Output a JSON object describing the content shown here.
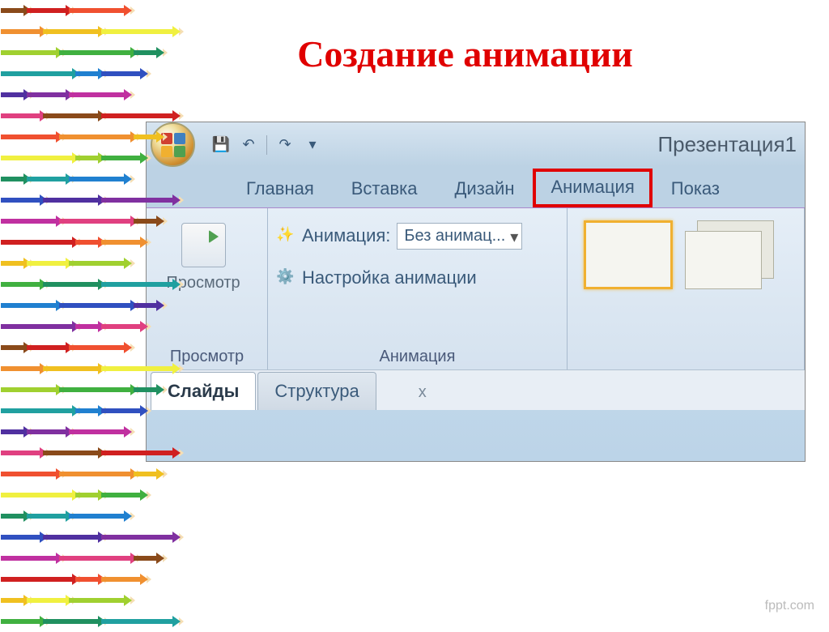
{
  "slide": {
    "title": "Создание анимации",
    "watermark": "fppt.com"
  },
  "app": {
    "doc_title": "Презентация1",
    "tabs": {
      "home": "Главная",
      "insert": "Вставка",
      "design": "Дизайн",
      "animation": "Анимация",
      "show": "Показ"
    },
    "ribbon": {
      "preview_group": {
        "button": "Просмотр",
        "label": "Просмотр"
      },
      "anim_group": {
        "row1_label": "Анимация:",
        "row1_value": "Без анимац...",
        "row2_label": "Настройка анимации",
        "label": "Анимация"
      }
    },
    "pane_tabs": {
      "slides": "Слайды",
      "outline": "Структура",
      "close": "x"
    },
    "qat": {
      "save": "💾",
      "undo": "↶",
      "redo": "↷",
      "more": "▾"
    }
  },
  "pencil_colors": [
    "#8a4a1a",
    "#d02020",
    "#f05030",
    "#f09030",
    "#f0c020",
    "#f0f040",
    "#a0d030",
    "#40b040",
    "#209060",
    "#20a0a0",
    "#2080d0",
    "#3050c0",
    "#5030a0",
    "#8030a0",
    "#c030a0",
    "#e04080"
  ]
}
